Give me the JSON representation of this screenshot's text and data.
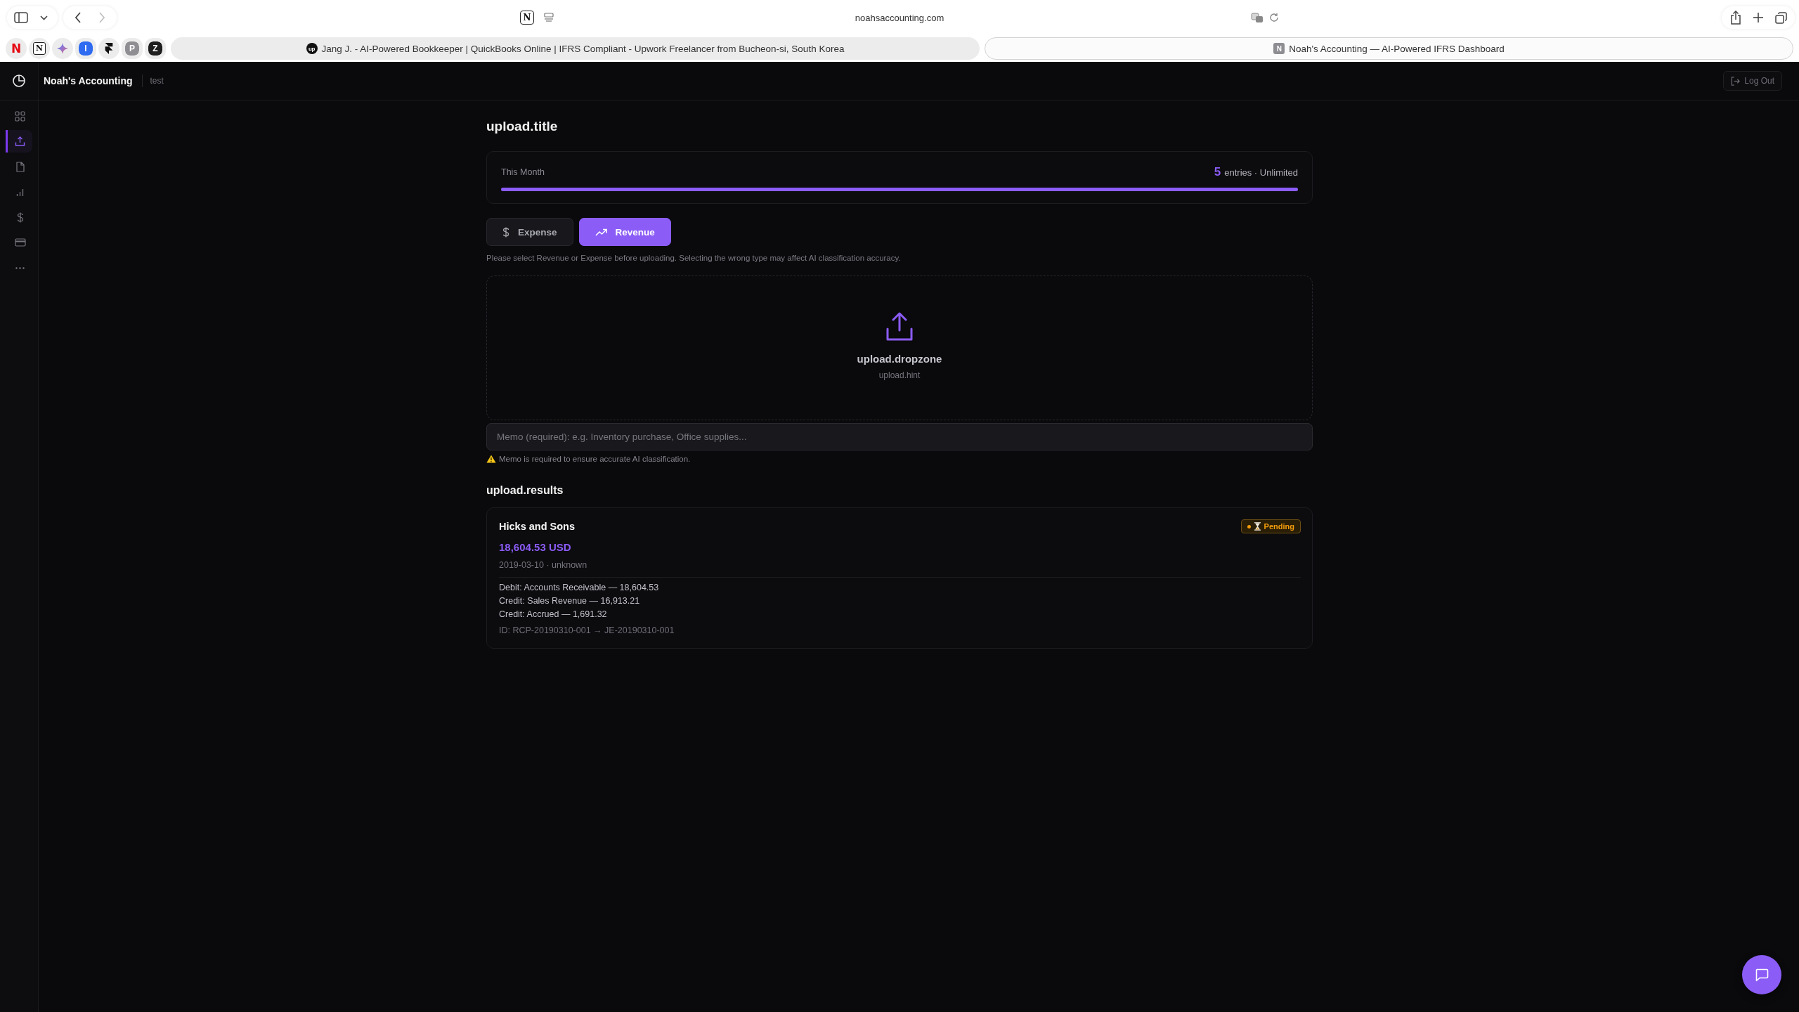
{
  "browser": {
    "nav_buttons": [
      {
        "kind": "back",
        "disabled": false
      },
      {
        "kind": "forward",
        "disabled": true
      }
    ],
    "extension_glyph": "N",
    "address": "noahsaccounting.com",
    "pinned_tabs": [
      {
        "kind": "letter",
        "glyph": "N",
        "color": "#e50914"
      },
      {
        "kind": "boxed",
        "glyph": "N"
      },
      {
        "kind": "sparkle"
      },
      {
        "kind": "tile",
        "glyph": "I",
        "color": "#2f6bf0"
      },
      {
        "kind": "framer"
      },
      {
        "kind": "tile",
        "glyph": "P",
        "color": "#8e8e93"
      },
      {
        "kind": "tile",
        "glyph": "Z",
        "color": "#1f1f1f"
      }
    ],
    "tabs": [
      {
        "title": "Jang J. - AI-Powered Bookkeeper | QuickBooks Online | IFRS Compliant - Upwork Freelancer from Bucheon-si, South Korea",
        "kind": "circle",
        "icon_glyph": "up",
        "selected": false
      },
      {
        "title": "Noah's Accounting — AI-Powered IFRS Dashboard",
        "kind": "tile",
        "icon_glyph": "N",
        "selected": true
      }
    ]
  },
  "app": {
    "brand": "Noah's Accounting",
    "workspace": "test",
    "logout": "Log Out",
    "nav": [
      {
        "kind": "grid",
        "selected": false
      },
      {
        "kind": "upload",
        "selected": true
      },
      {
        "kind": "file",
        "selected": false
      },
      {
        "kind": "chart",
        "selected": false
      },
      {
        "kind": "dollar",
        "selected": false
      },
      {
        "kind": "card",
        "selected": false
      },
      {
        "kind": "more",
        "selected": false
      }
    ],
    "title": "upload.title",
    "usage": {
      "label": "This Month",
      "count": "5",
      "text": "entries · Unlimited",
      "level": 1
    },
    "entry_types": [
      {
        "kind": "dollar",
        "label": "Expense",
        "selected": false
      },
      {
        "kind": "trend",
        "label": "Revenue",
        "selected": true
      }
    ],
    "type_note": "Please select Revenue or Expense before uploading. Selecting the wrong type may affect AI classification accuracy.",
    "dropzone": {
      "title": "upload.dropzone",
      "hint": "upload.hint"
    },
    "memo": {
      "placeholder": "Memo (required): e.g. Inventory purchase, Office supplies..."
    },
    "memo_warning": "Memo is required to ensure accurate AI classification.",
    "results_title": "upload.results",
    "results": [
      {
        "vendor": "Hicks and Sons",
        "amount": "18,604.53 USD",
        "meta": "2019-03-10 · unknown",
        "status": {
          "kind": "pending",
          "label": "Pending"
        },
        "lines": [
          "Debit: Accounts Receivable — 18,604.53",
          "Credit: Sales Revenue — 16,913.21",
          "Credit: Accrued — 1,691.32"
        ],
        "reference": "ID: RCP-20190310-001 → JE-20190310-001"
      }
    ]
  }
}
